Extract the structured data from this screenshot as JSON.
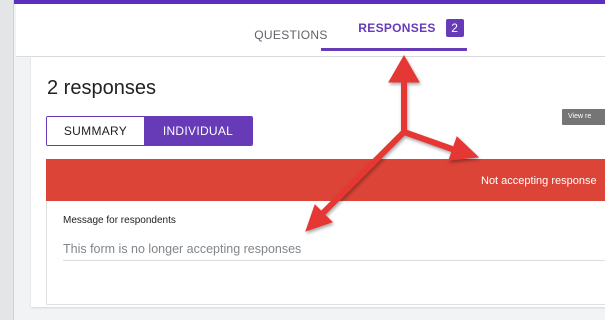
{
  "tabs": {
    "questions": "QUESTIONS",
    "responses": "RESPONSES",
    "responses_count": "2"
  },
  "main": {
    "title": "2 responses",
    "toggle": {
      "summary": "SUMMARY",
      "individual": "INDIVIDUAL"
    },
    "view_button": "View re",
    "banner": "Not accepting response",
    "message_label": "Message for respondents",
    "message_value": "This form is no longer accepting responses"
  },
  "colors": {
    "accent": "#673ab7",
    "banner": "#db4437",
    "annotation_arrow": "#e53935"
  },
  "annotations": [
    "arrow-up-to-responses-tab",
    "arrow-right-to-banner",
    "arrow-down-left-to-message"
  ]
}
